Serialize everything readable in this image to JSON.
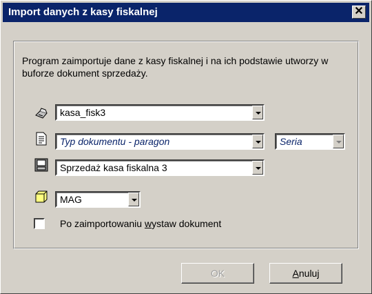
{
  "window": {
    "title": "Import danych z kasy fiskalnej",
    "close_glyph": "✕"
  },
  "description": "Program zaimportuje dane z kasy fiskalnej i na ich podstawie utworzy w buforze dokument sprzedaży.",
  "fields": {
    "device": {
      "value": "kasa_fisk3",
      "icon": "cash-register-icon"
    },
    "doc_type": {
      "value": "Typ dokumentu - paragon",
      "icon": "document-icon"
    },
    "series": {
      "value": "Seria"
    },
    "register": {
      "value": "Sprzedaż kasa fiskalna 3",
      "icon": "register-book-icon"
    },
    "warehouse": {
      "value": "MAG",
      "icon": "warehouse-box-icon"
    }
  },
  "checkbox": {
    "label_before": "Po zaimportowaniu ",
    "label_underlined": "w",
    "label_after": "ystaw dokument",
    "checked": false
  },
  "buttons": {
    "ok": "OK",
    "cancel_underlined": "A",
    "cancel_rest": "nuluj"
  },
  "colors": {
    "titlebar": "#0a246a",
    "face": "#d4d0c8"
  }
}
